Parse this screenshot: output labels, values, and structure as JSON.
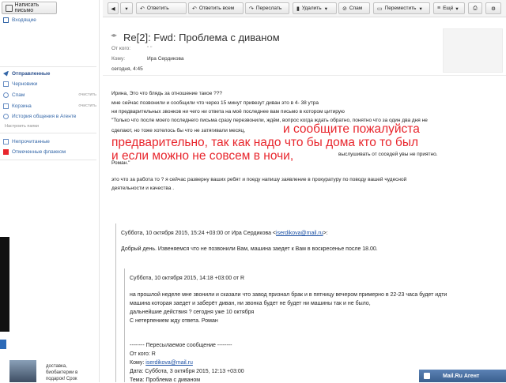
{
  "sidebar": {
    "compose_label": "Написать письмо",
    "inbox_label": "Входящие",
    "folders": [
      {
        "label": "Отправленные",
        "action": ""
      },
      {
        "label": "Черновики",
        "action": ""
      },
      {
        "label": "Спам",
        "action": "очистить"
      },
      {
        "label": "Корзина",
        "action": "очистить"
      },
      {
        "label": "История общения в Агенте",
        "action": ""
      }
    ],
    "settings_link": "Настроить папки",
    "filters": [
      {
        "label": "Непрочитанные"
      },
      {
        "label": "Отмеченные флажком"
      }
    ],
    "promo_text": "доставка, биобактерии в подарок! Срок"
  },
  "toolbar": {
    "reply": "Ответить",
    "reply_all": "Ответить всем",
    "forward": "Переслать",
    "delete": "Удалить",
    "spam": "Спам",
    "move": "Переместить",
    "more": "Ещё"
  },
  "message": {
    "subject": "Re[2]: Fwd: Проблема с диваном",
    "from_label": "От кого:",
    "from_value": "\"                         \"                 ",
    "to_label": "Кому:",
    "to_value": "Ира Сердикова",
    "date_value": "сегодня, 4:45",
    "body_lines": [
      "Ирина, Это что блядь за отношение такое ???",
      "мне сейчас позвонили и сообщили что через 15 минут привезут диван это в 4- 38 утра",
      "ни предварительных звонков ни чего ни ответа на моё последнее вам  письмо в котором цитирую",
      "\"Только что после моего последнего письма сразу перезвонили, ждём, вопрос когда ждать обратно, понятно что за один два дня не",
      "сделают, но тоже хотелось бы что не затягивали месяц,",
      "выслушивать от соседей увы не приятно.",
      "Роман.\"",
      "это что за работа то ? я сейчас разверну ваших ребят и поеду напишу заявление в прокуратуру  по поводу вашей чудесной",
      " деятельности и качества ."
    ],
    "red_lines": [
      "и сообщите пожалуйста",
      "предварительно, так как надо что бы  дома кто то был",
      "и если можно не совсем в ночи,"
    ],
    "quote1_header_pre": "Суббота, 10 октября 2015, 15:24 +03:00 от Ира Сердикова <",
    "quote1_email": "iserdikova@mail.ru",
    "quote1_header_post": ">:",
    "quote1_body": "Добрый день. Извеняемся что не позвонили Вам, машина заедет к Вам в воскресенье после 18.00.",
    "quote2_header": "Суббота, 10 октября 2015, 14:18 +03:00 от R",
    "quote2_lines": [
      "на прошлой неделе мне звонили и сказали что завод признал брак и в пятницу вечером примерно в 22-23 часа будет идти",
      "машина которая заедет и заберёт диван, ни звонка будет не будет ни машины  так и не было,",
      "дальнейшие действия ?  сегодня уже 10 октября",
      "С нетерпением жду ответа. Роман"
    ],
    "fwd_title": "-------- Пересылаемое сообщение --------",
    "fwd_from": "От кого: R",
    "fwd_to_pre": "Кому: ",
    "fwd_to_email": "iserdikova@mail.ru",
    "fwd_date": "Дата: Суббота, 3 октября 2015, 12:13 +03:00",
    "fwd_subject": "Тема: Проблема с диваном"
  },
  "agent_label": "Mail.Ru Агент",
  "colors": {
    "accent": "#3467a8",
    "red_text": "#e8262d",
    "link": "#1a4fa3"
  }
}
